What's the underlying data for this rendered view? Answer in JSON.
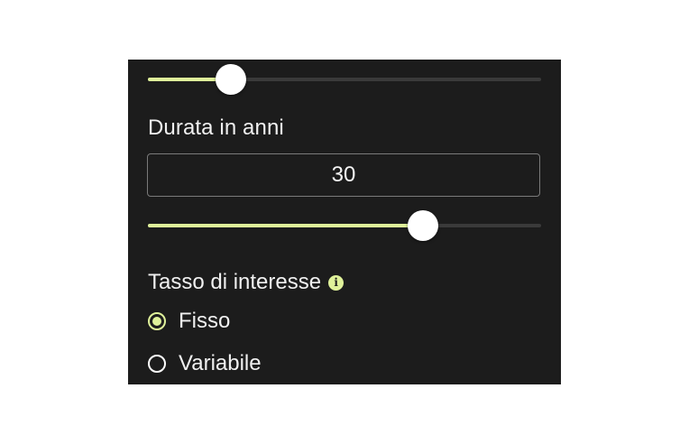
{
  "colors": {
    "accent": "#dff19a",
    "panel_background": "#1c1c1c",
    "track": "#3a3a3a",
    "thumb": "#ffffff"
  },
  "amount_slider": {
    "value_fraction": 0.21
  },
  "duration": {
    "label": "Durata in anni",
    "value": "30",
    "slider_fraction": 0.7
  },
  "interest_rate": {
    "label": "Tasso di interesse",
    "info_icon": "info-icon",
    "options": [
      {
        "label": "Fisso",
        "checked": true
      },
      {
        "label": "Variabile",
        "checked": false
      }
    ]
  }
}
